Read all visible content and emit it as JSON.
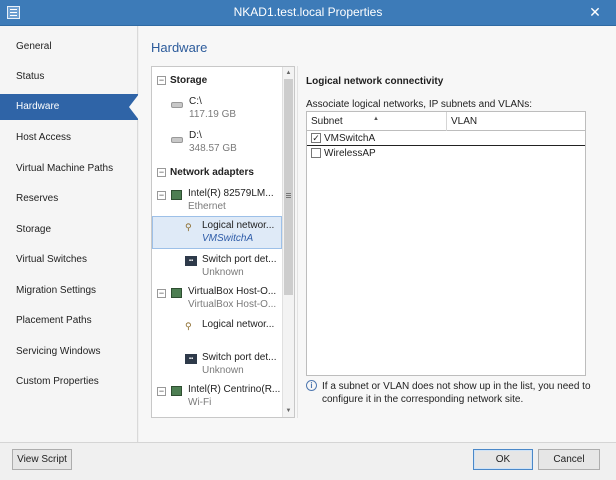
{
  "window": {
    "title": "NKAD1.test.local Properties",
    "close_glyph": "✕"
  },
  "nav": {
    "items": [
      {
        "label": "General"
      },
      {
        "label": "Status"
      },
      {
        "label": "Hardware",
        "active": true
      },
      {
        "label": "Host Access"
      },
      {
        "label": "Virtual Machine Paths"
      },
      {
        "label": "Reserves"
      },
      {
        "label": "Storage"
      },
      {
        "label": "Virtual Switches"
      },
      {
        "label": "Migration Settings"
      },
      {
        "label": "Placement Paths"
      },
      {
        "label": "Servicing Windows"
      },
      {
        "label": "Custom Properties"
      }
    ]
  },
  "page": {
    "title": "Hardware"
  },
  "tree": {
    "storage_header": "Storage",
    "disks": [
      {
        "name": "C:\\",
        "size": "117.19 GB"
      },
      {
        "name": "D:\\",
        "size": "348.57 GB"
      }
    ],
    "network_header": "Network adapters",
    "adapters": [
      {
        "name": "Intel(R) 82579LM...",
        "type": "Ethernet"
      },
      {
        "name": "VirtualBox Host-O...",
        "type": "VirtualBox Host-O..."
      },
      {
        "name": "Intel(R) Centrino(R...",
        "type": "Wi-Fi"
      }
    ],
    "children": {
      "logical_network": "Logical networ...",
      "logical_network_value": "VMSwitchA",
      "switch_port": "Switch port det...",
      "switch_port_value": "Unknown",
      "logical_network_2": "Logical networ...",
      "switch_port_2": "Switch port det...",
      "switch_port_2_value": "Unknown"
    },
    "expand_glyph": "⊟",
    "collapse_glyph": "−"
  },
  "detail": {
    "title": "Logical network connectivity",
    "description": "Associate logical networks, IP subnets and VLANs:",
    "columns": {
      "subnet": "Subnet",
      "vlan": "VLAN"
    },
    "rows": [
      {
        "label": "VMSwitchA",
        "checked": true
      },
      {
        "label": "WirelessAP",
        "checked": false
      }
    ],
    "info_text": "If a subnet or VLAN does not show up in the list, you need to configure it in the corresponding network site."
  },
  "footer": {
    "view_script": "View Script",
    "ok": "OK",
    "cancel": "Cancel"
  }
}
